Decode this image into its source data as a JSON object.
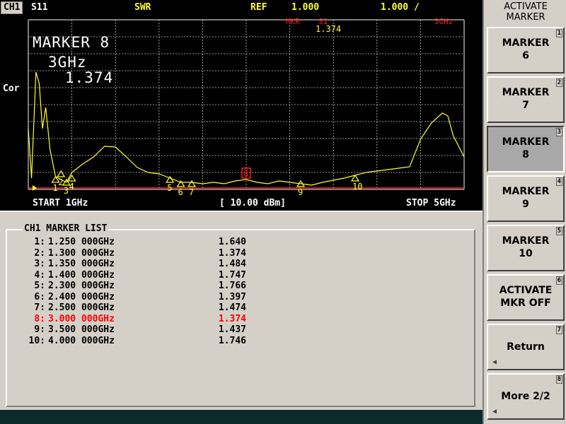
{
  "header": {
    "channel": "CH1",
    "param": "S11",
    "format": "SWR",
    "ref_label": "REF",
    "ref_value": "1.000",
    "scale": "1.000 /",
    "mkr_label": "MKR",
    "mkr_param": "S1",
    "mkr_freq": "3GHz",
    "mkr_value": "1.374"
  },
  "trace": {
    "y_label": "Cor",
    "start": "START 1GHz",
    "power": "[ 10.00 dBm]",
    "stop": "STOP 5GHz",
    "active_marker_name": "MARKER 8",
    "active_marker_freq": "3GHz",
    "active_marker_value": "1.374",
    "marker_tags": [
      {
        "label": "1",
        "f": 1.25
      },
      {
        "label": "2",
        "f": 1.3
      },
      {
        "label": "3",
        "f": 1.35
      },
      {
        "label": "4",
        "f": 1.4
      },
      {
        "label": "5",
        "f": 2.3
      },
      {
        "label": "6",
        "f": 2.4
      },
      {
        "label": "7",
        "f": 2.5
      },
      {
        "label": "8",
        "f": 3.0
      },
      {
        "label": "9",
        "f": 3.5
      },
      {
        "label": "10",
        "f": 4.0
      }
    ],
    "colors": {
      "trace": "#ffff33",
      "grid": "#c8c8c8",
      "marker": "#ffff33",
      "active_marker": "#ff2020",
      "ref_line": "#ff2020"
    }
  },
  "marker_list": {
    "title": "CH1 MARKER LIST",
    "rows": [
      {
        "idx": "1:",
        "freq": "1.250 000GHz",
        "value": "1.640"
      },
      {
        "idx": "2:",
        "freq": "1.300 000GHz",
        "value": "1.374"
      },
      {
        "idx": "3:",
        "freq": "1.350 000GHz",
        "value": "1.484"
      },
      {
        "idx": "4:",
        "freq": "1.400 000GHz",
        "value": "1.747"
      },
      {
        "idx": "5:",
        "freq": "2.300 000GHz",
        "value": "1.766"
      },
      {
        "idx": "6:",
        "freq": "2.400 000GHz",
        "value": "1.397"
      },
      {
        "idx": "7:",
        "freq": "2.500 000GHz",
        "value": "1.474"
      },
      {
        "idx": "8:",
        "freq": "3.000 000GHz",
        "value": "1.374",
        "active": true
      },
      {
        "idx": "9:",
        "freq": "3.500 000GHz",
        "value": "1.437"
      },
      {
        "idx": "10:",
        "freq": "4.000 000GHz",
        "value": "1.746"
      }
    ]
  },
  "softkeys": {
    "title_line1": "ACTIVATE",
    "title_line2": "MARKER",
    "keys": [
      {
        "line1": "MARKER",
        "line2": "6",
        "num": "1"
      },
      {
        "line1": "MARKER",
        "line2": "7",
        "num": "2"
      },
      {
        "line1": "MARKER",
        "line2": "8",
        "num": "3",
        "selected": true
      },
      {
        "line1": "MARKER",
        "line2": "9",
        "num": "4"
      },
      {
        "line1": "MARKER",
        "line2": "10",
        "num": "5"
      },
      {
        "line1": "ACTIVATE",
        "line2": "MKR OFF",
        "num": "6"
      },
      {
        "line1": "Return",
        "line2": "",
        "num": "7",
        "arrow": true
      },
      {
        "line1": "More 2/2",
        "line2": "",
        "num": "8",
        "arrow": true
      }
    ]
  }
}
